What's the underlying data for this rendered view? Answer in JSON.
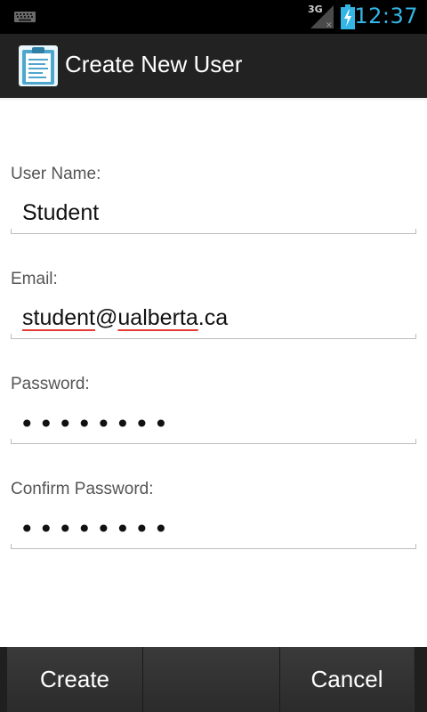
{
  "status_bar": {
    "network": "3G",
    "time": "12:37",
    "icons": [
      "keyboard-icon",
      "signal-icon",
      "battery-charging-icon"
    ],
    "clock_color": "#33b5e5"
  },
  "action_bar": {
    "title": "Create New User",
    "app_icon": "clipboard-icon",
    "background": "#222222"
  },
  "form": {
    "username": {
      "label": "User Name:",
      "value": "Student"
    },
    "email": {
      "label": "Email:",
      "value_parts": [
        "student",
        "@",
        "ualberta",
        ".ca"
      ],
      "spellcheck_color": "#e53935"
    },
    "password": {
      "label": "Password:",
      "masked": "••••••••"
    },
    "confirm_password": {
      "label": "Confirm Password:",
      "masked": "••••••••"
    }
  },
  "buttons": {
    "create": "Create",
    "cancel": "Cancel"
  }
}
